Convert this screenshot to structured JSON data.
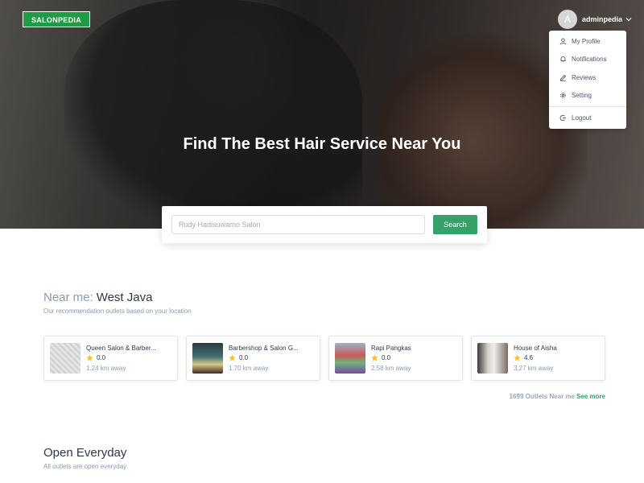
{
  "brand": {
    "logo_text": "SALONPEDIA"
  },
  "user": {
    "avatar_initial": "A",
    "name": "adminpedia",
    "menu": [
      {
        "label": "My Profile",
        "icon": "user-icon"
      },
      {
        "label": "Notifications",
        "icon": "bell-icon"
      },
      {
        "label": "Reviews",
        "icon": "pencil-icon"
      },
      {
        "label": "Setting",
        "icon": "gear-icon"
      },
      {
        "label": "Logout",
        "icon": "logout-icon"
      }
    ]
  },
  "hero": {
    "title": "Find The Best Hair Service Near You"
  },
  "search": {
    "placeholder": "Rudy Hadisuwarno Salon",
    "button_label": "Search"
  },
  "near_me": {
    "prefix": "Near me:",
    "region": "West Java",
    "subtitle": "Our recommendation outlets based on your location",
    "outlets": [
      {
        "name": "Queen Salon & Barber...",
        "rating": "0.0",
        "distance": "1.24 km away"
      },
      {
        "name": "Barbershop & Salon G...",
        "rating": "0.0",
        "distance": "1.70 km away"
      },
      {
        "name": "Rapi Pangkas",
        "rating": "0.0",
        "distance": "2.58 km away"
      },
      {
        "name": "House of Aisha",
        "rating": "4.6",
        "distance": "3.27 km away"
      }
    ],
    "count_text": "1699 Outlets Near me",
    "see_more": "See more"
  },
  "open_everyday": {
    "title": "Open Everyday",
    "subtitle": "All outlets are open everyday"
  },
  "colors": {
    "brand_green": "#1e9c45",
    "button_green": "#38a169",
    "star": "#f6c026",
    "muted": "#8a9bb0"
  }
}
